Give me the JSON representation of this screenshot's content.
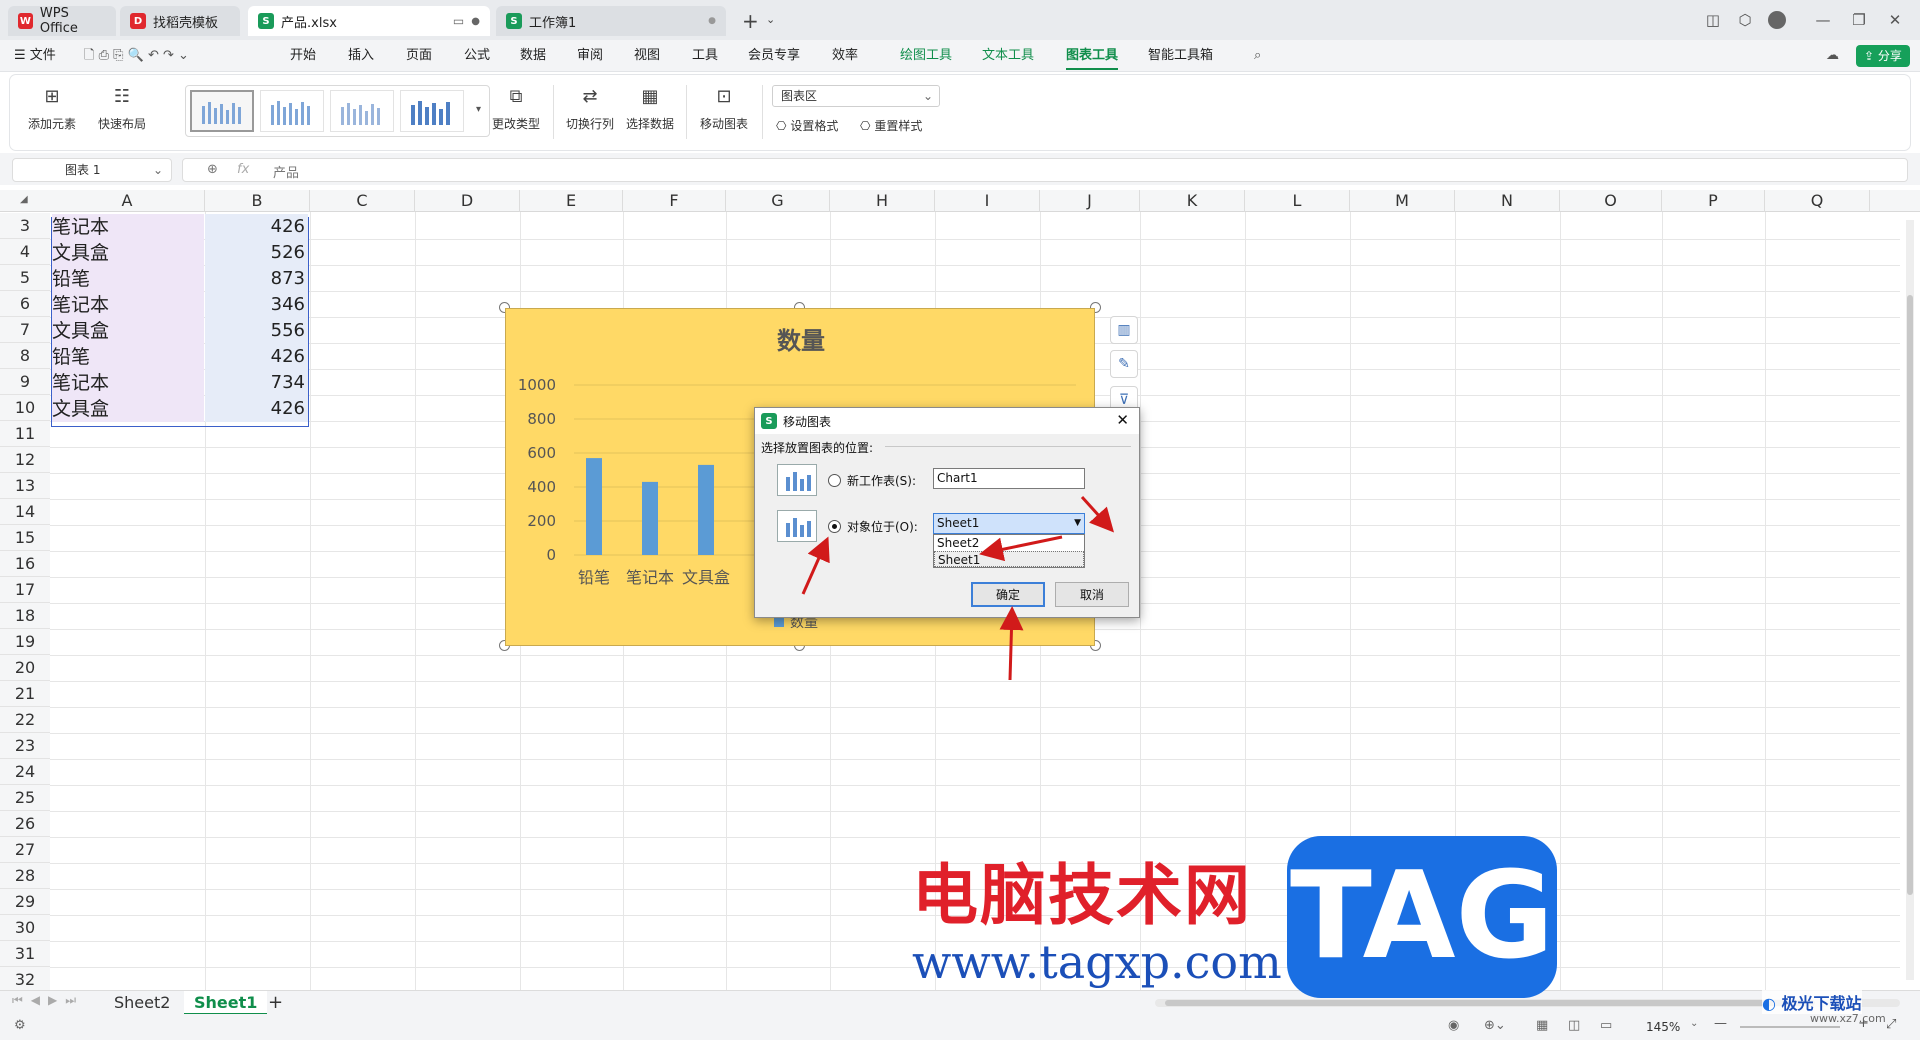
{
  "tabs": [
    {
      "label": "WPS Office",
      "icon": "wps-logo"
    },
    {
      "label": "找稻壳模板",
      "icon": "docer-icon"
    },
    {
      "label": "产品.xlsx",
      "icon": "sheet-icon"
    },
    {
      "label": "工作簿1",
      "icon": "sheet-icon"
    }
  ],
  "menu": {
    "file": "文件",
    "items": [
      "开始",
      "插入",
      "页面",
      "公式",
      "数据",
      "审阅",
      "视图",
      "工具",
      "会员专享",
      "效率"
    ],
    "context": [
      "绘图工具",
      "文本工具",
      "图表工具",
      "智能工具箱"
    ],
    "selected": "图表工具",
    "share": "分享"
  },
  "ribbon": {
    "add_element": "添加元素",
    "quick_layout": "快速布局",
    "change_type": "更改类型",
    "switch_rowcol": "切换行列",
    "select_data": "选择数据",
    "move_chart": "移动图表",
    "chart_area_select": "图表区",
    "set_format": "设置格式",
    "reset_style": "重置样式"
  },
  "formula": {
    "name_box": "图表 1",
    "fx": "fx",
    "content": "产品"
  },
  "columns": [
    "A",
    "B",
    "C",
    "D",
    "E",
    "F",
    "G",
    "H",
    "I",
    "J",
    "K",
    "L",
    "M",
    "N",
    "O",
    "P",
    "Q"
  ],
  "rows": [
    "3",
    "4",
    "5",
    "6",
    "7",
    "8",
    "9",
    "10",
    "11",
    "12",
    "13",
    "14",
    "15",
    "16",
    "17",
    "18",
    "19",
    "20",
    "21",
    "22",
    "23",
    "24",
    "25",
    "26",
    "27",
    "28",
    "29",
    "30",
    "31",
    "32"
  ],
  "cells": [
    {
      "a": "笔记本",
      "b": "426"
    },
    {
      "a": "文具盒",
      "b": "526"
    },
    {
      "a": "铅笔",
      "b": "873"
    },
    {
      "a": "笔记本",
      "b": "346"
    },
    {
      "a": "文具盒",
      "b": "556"
    },
    {
      "a": "铅笔",
      "b": "426"
    },
    {
      "a": "笔记本",
      "b": "734"
    },
    {
      "a": "文具盒",
      "b": "426"
    }
  ],
  "chart_data": {
    "type": "bar",
    "title": "数量",
    "categories": [
      "铅笔",
      "笔记本",
      "文具盒",
      "铅"
    ],
    "series": [
      {
        "name": "数量",
        "values": [
          570,
          430,
          530,
          null
        ]
      }
    ],
    "yticks": [
      "1000",
      "800",
      "600",
      "400",
      "200",
      "0"
    ],
    "ylim": [
      0,
      1000
    ],
    "legend": "bottom",
    "grid": true,
    "background": "#ffd966",
    "bar_color": "#5b9bd5"
  },
  "dialog": {
    "title": "移动图表",
    "prompt": "选择放置图表的位置:",
    "new_sheet_label": "新工作表(S):",
    "new_sheet_value": "Chart1",
    "object_in_label": "对象位于(O):",
    "object_in_value": "Sheet1",
    "options": [
      "Sheet2",
      "Sheet1"
    ],
    "ok": "确定",
    "cancel": "取消"
  },
  "sheets": {
    "items": [
      "Sheet2",
      "Sheet1"
    ],
    "active": "Sheet1",
    "add": "+"
  },
  "status": {
    "zoom": "145%"
  },
  "watermark": {
    "text": "电脑技术网",
    "url": "www.tagxp.com",
    "tag": "TAG",
    "corner": "极光下载站",
    "corner_url": "www.xz7.com"
  }
}
